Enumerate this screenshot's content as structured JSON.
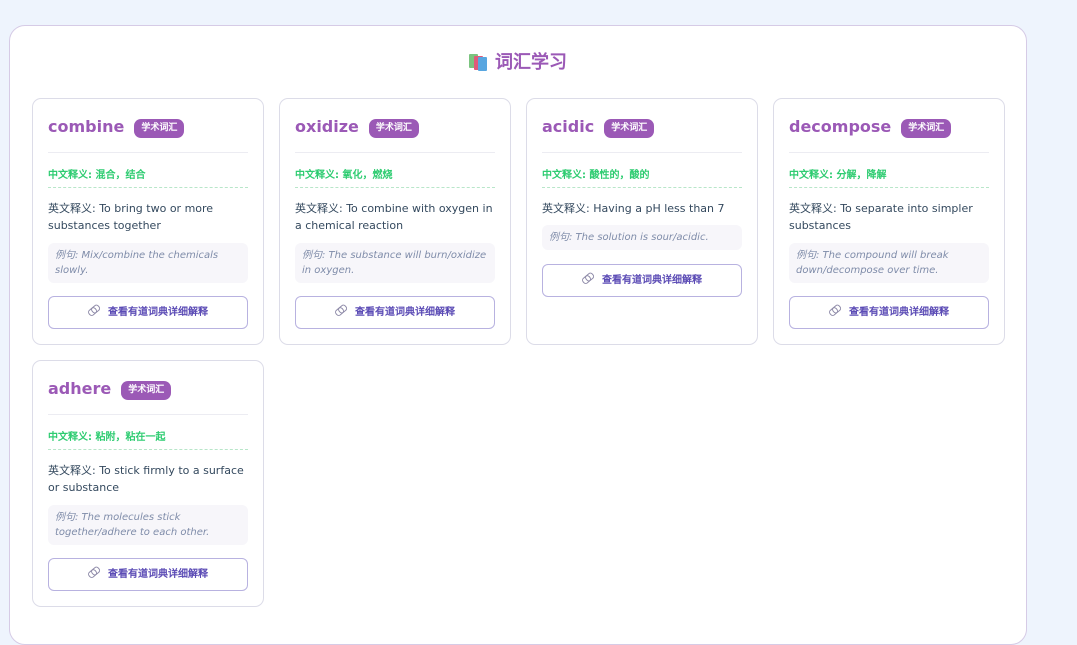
{
  "header": {
    "icon": "books-icon",
    "title": "词汇学习"
  },
  "colors": {
    "accent": "#9b59b6",
    "chinese_meaning": "#2ecc71",
    "button_text": "#5b4bb5"
  },
  "cards": [
    {
      "word": "combine",
      "badge": "学术词汇",
      "chinese": "中文释义: 混合，结合",
      "english": "英文释义: To bring two or more substances together",
      "example": "例句: Mix/combine the chemicals slowly.",
      "button": "查看有道词典详细解释"
    },
    {
      "word": "oxidize",
      "badge": "学术词汇",
      "chinese": "中文释义: 氧化，燃烧",
      "english": "英文释义: To combine with oxygen in a chemical reaction",
      "example": "例句: The substance will burn/oxidize in oxygen.",
      "button": "查看有道词典详细解释"
    },
    {
      "word": "acidic",
      "badge": "学术词汇",
      "chinese": "中文释义: 酸性的，酸的",
      "english": "英文释义: Having a pH less than 7",
      "example": "例句: The solution is sour/acidic.",
      "button": "查看有道词典详细解释"
    },
    {
      "word": "decompose",
      "badge": "学术词汇",
      "chinese": "中文释义: 分解，降解",
      "english": "英文释义: To separate into simpler substances",
      "example": "例句: The compound will break down/decompose over time.",
      "button": "查看有道词典详细解释"
    },
    {
      "word": "adhere",
      "badge": "学术词汇",
      "chinese": "中文释义: 粘附，粘在一起",
      "english": "英文释义: To stick firmly to a surface or substance",
      "example": "例句: The molecules stick together/adhere to each other.",
      "button": "查看有道词典详细解释"
    }
  ]
}
